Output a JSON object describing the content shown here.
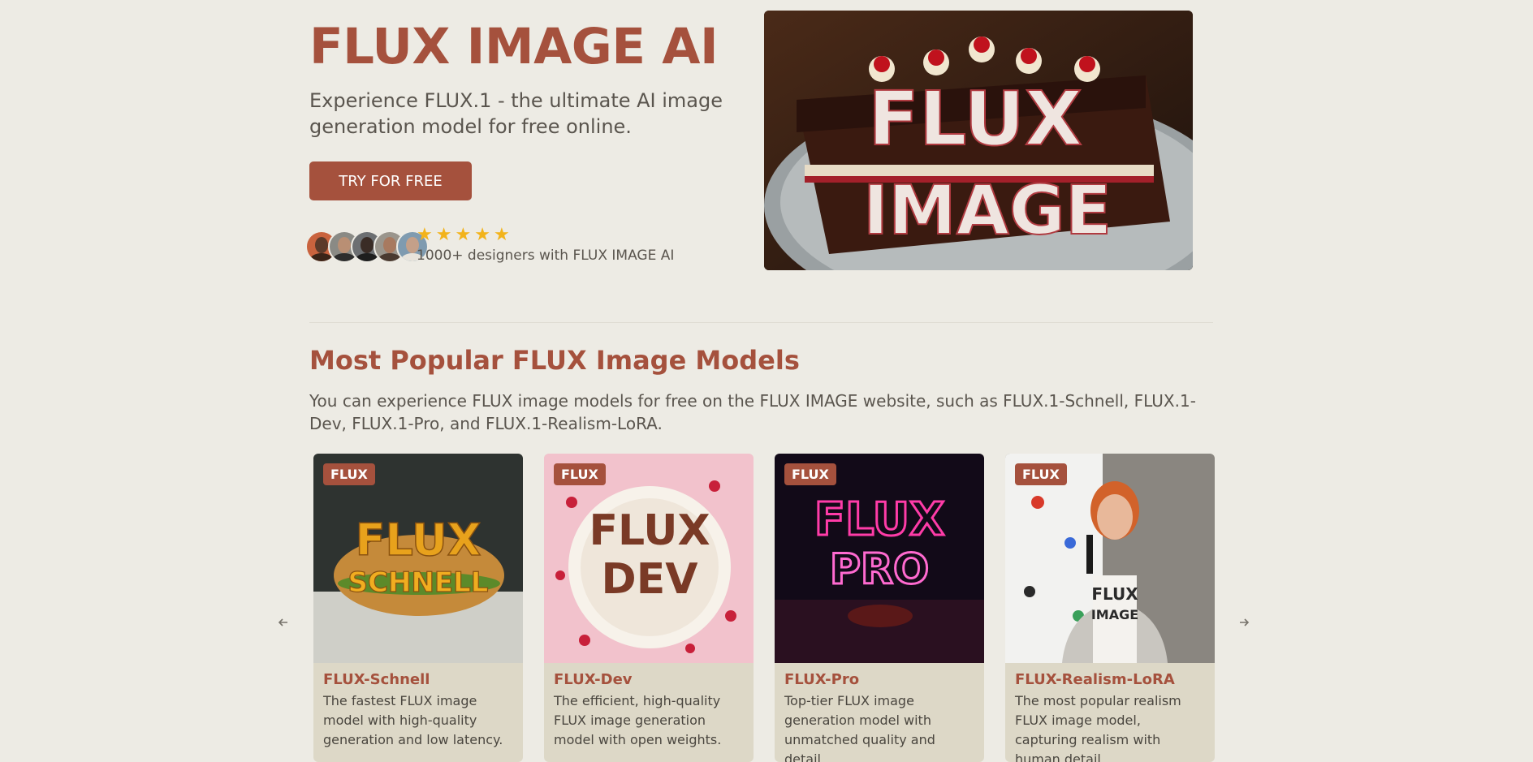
{
  "hero": {
    "title": "FLUX IMAGE AI",
    "subtitle": "Experience FLUX.1 - the ultimate AI image generation model for free online.",
    "cta_label": "TRY FOR FREE",
    "rating_stars": 5,
    "rating_text": "1000+ designers with FLUX IMAGE AI",
    "image_word_top": "FLUX",
    "image_word_bottom": "IMAGE"
  },
  "models": {
    "title": "Most Popular FLUX Image Models",
    "description": "You can experience FLUX image models for free on the FLUX IMAGE website, such as FLUX.1-Schnell, FLUX.1-Dev, FLUX.1-Pro, and FLUX.1-Realism-LoRA.",
    "prev_icon": "arrow-left-icon",
    "next_icon": "arrow-right-icon",
    "cards": [
      {
        "badge": "FLUX",
        "title": "FLUX-Schnell",
        "description": "The fastest FLUX image model with high-quality generation and low latency.",
        "img_line1": "FLUX",
        "img_line2": "SCHNELL"
      },
      {
        "badge": "FLUX",
        "title": "FLUX-Dev",
        "description": "The efficient, high-quality FLUX image generation model with open weights.",
        "img_line1": "FLUX",
        "img_line2": "DEV"
      },
      {
        "badge": "FLUX",
        "title": "FLUX-Pro",
        "description": "Top-tier FLUX image generation model with unmatched quality and detail.",
        "img_line1": "FLUX",
        "img_line2": "PRO"
      },
      {
        "badge": "FLUX",
        "title": "FLUX-Realism-LoRA",
        "description": "The most popular realism FLUX image model, capturing realism with human detail.",
        "img_line1": "FLUX",
        "img_line2": "IMAGE"
      }
    ]
  },
  "colors": {
    "accent": "#a5513d",
    "background": "#edebe4",
    "card_bg": "#ddd8c7",
    "star": "#f2b31b"
  }
}
